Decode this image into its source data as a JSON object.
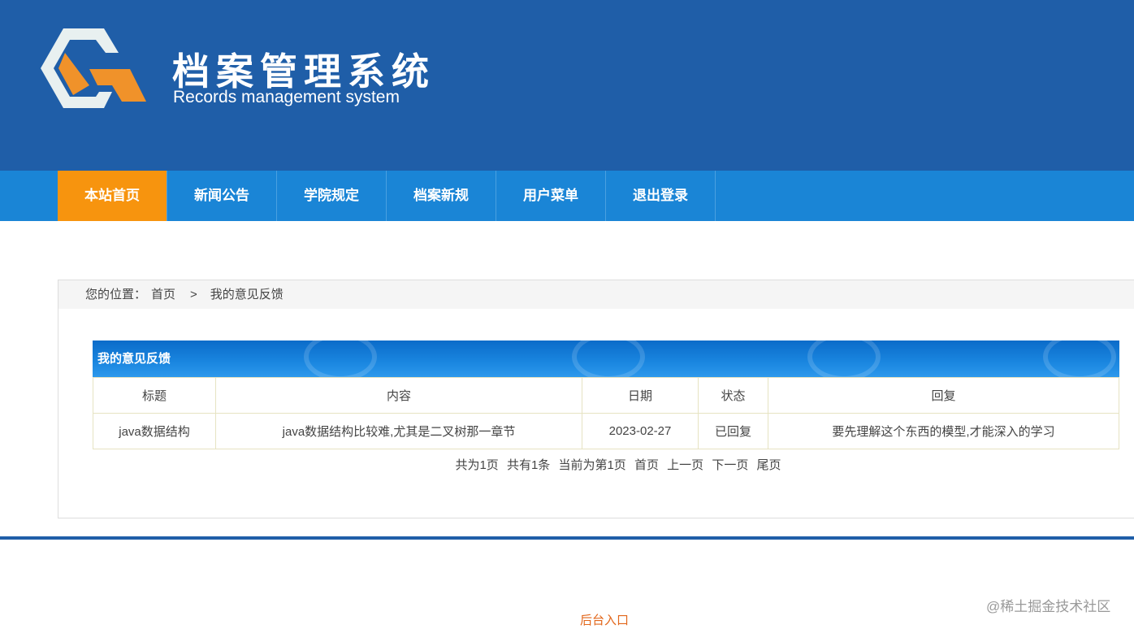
{
  "header": {
    "title": "档案管理系统",
    "subtitle": "Records management system"
  },
  "nav": [
    "本站首页",
    "新闻公告",
    "学院规定",
    "档案新规",
    "用户菜单",
    "退出登录"
  ],
  "breadcrumb": {
    "label": "您的位置：",
    "home": "首页",
    "sep": ">",
    "current": "我的意见反馈"
  },
  "panel": {
    "title": "我的意见反馈",
    "columns": [
      "标题",
      "内容",
      "日期",
      "状态",
      "回复"
    ],
    "rows": [
      [
        "java数据结构",
        "java数据结构比较难,尤其是二叉树那一章节",
        "2023-02-27",
        "已回复",
        "要先理解这个东西的模型,才能深入的学习"
      ]
    ]
  },
  "pager": [
    "共为1页",
    "共有1条",
    "当前为第1页",
    "首页",
    "上一页",
    "下一页",
    "尾页"
  ],
  "footer": {
    "admin_link": "后台入口",
    "watermark": "@稀土掘金技术社区"
  },
  "colors": {
    "header": "#1f5ea8",
    "nav": "#1a85d6",
    "active": "#f7940e"
  }
}
